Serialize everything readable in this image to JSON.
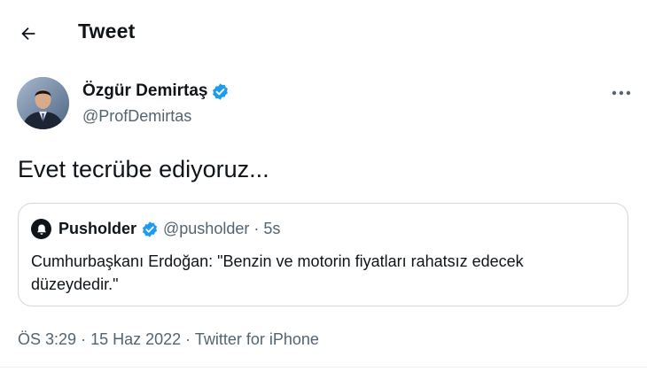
{
  "header": {
    "title": "Tweet",
    "back_icon": "back-arrow-icon"
  },
  "tweet": {
    "author": {
      "name": "Özgür Demirtaş",
      "handle": "@ProfDemirtas",
      "verified": true
    },
    "text": "Evet tecrübe ediyoruz...",
    "quote": {
      "name": "Pusholder",
      "handle": "@pusholder",
      "separator": "·",
      "time": "5s",
      "verified": true,
      "text": "Cumhurbaşkanı Erdoğan: \"Benzin ve motorin fiyatları rahatsız edecek düzeydedir.\""
    },
    "meta": {
      "time": "ÖS 3:29",
      "separator_1": "·",
      "date": "15 Haz 2022",
      "separator_2": "·",
      "source": "Twitter for iPhone"
    }
  },
  "colors": {
    "verified": "#1d9bf0",
    "text_primary": "#0f1419",
    "text_secondary": "#536471",
    "border": "#cfd9de"
  }
}
